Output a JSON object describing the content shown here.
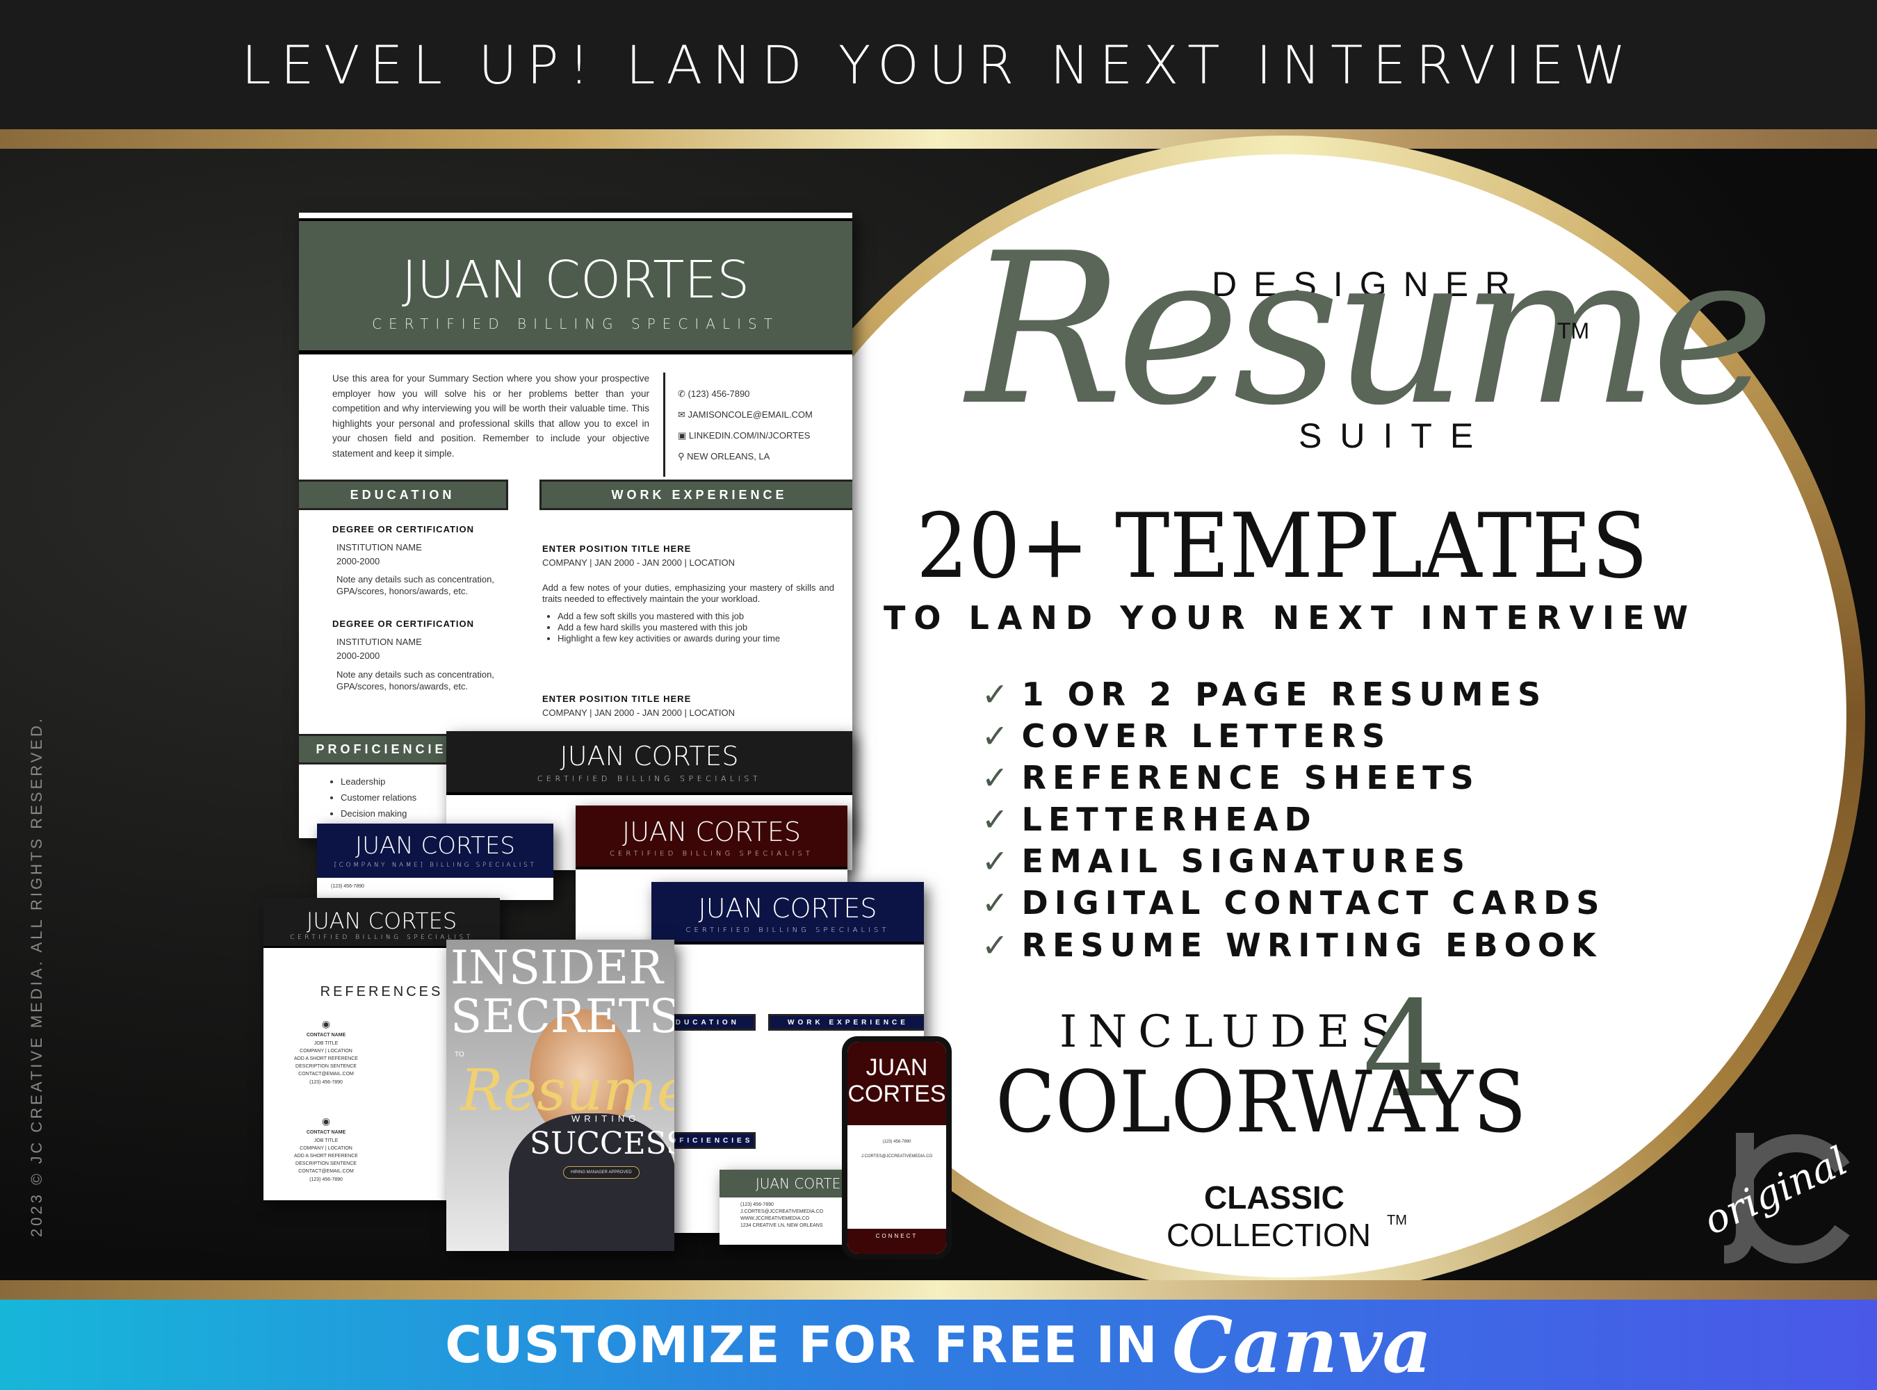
{
  "header": {
    "title": "LEVEL UP! LAND YOUR NEXT INTERVIEW"
  },
  "copyright": "2023 © JC CREATIVE MEDIA. ALL RIGHTS RESERVED.",
  "colors": {
    "green": "#4d5c4d",
    "navy": "#0c1446",
    "maroon": "#3d0606",
    "black": "#1b1b1b",
    "canva_start": "#17b6d9",
    "canva_end": "#4a58e8",
    "gold": "#c9a863"
  },
  "product": {
    "designer": "DESIGNER",
    "resume_script": "Resume",
    "tm": "TM",
    "suite": "SUITE",
    "templates": "20+ TEMPLATES",
    "tagline": "TO LAND YOUR NEXT INTERVIEW",
    "features": [
      {
        "icon": "check-icon",
        "label": "1 OR 2 PAGE RESUMES"
      },
      {
        "icon": "check-icon",
        "label": "COVER LETTERS"
      },
      {
        "icon": "check-icon",
        "label": "REFERENCE SHEETS"
      },
      {
        "icon": "check-icon",
        "label": "LETTERHEAD"
      },
      {
        "icon": "check-icon",
        "label": "EMAIL SIGNATURES"
      },
      {
        "icon": "check-icon",
        "label": "DIGITAL CONTACT CARDS"
      },
      {
        "icon": "check-icon",
        "label": "RESUME WRITING EBOOK"
      }
    ],
    "includes": "INCLUDES",
    "number": "4",
    "colorways": "COLORWAYS",
    "classic": "CLASSIC",
    "collection": "COLLECTION",
    "collection_tm": "TM",
    "logo": "JC original"
  },
  "resume": {
    "name": "JUAN CORTES",
    "title": "CERTIFIED BILLING SPECIALIST",
    "summary": "Use this area for your Summary Section where you show your prospective employer how you will solve his or her problems better than your competition and why interviewing you will be worth their valuable time. This highlights your personal and professional skills that allow you to excel in your chosen field and position. Remember to include your objective statement and keep it simple.",
    "contact": [
      {
        "icon": "phone-icon",
        "text": "(123) 456-7890"
      },
      {
        "icon": "email-icon",
        "text": "JAMISONCOLE@EMAIL.COM"
      },
      {
        "icon": "linkedin-icon",
        "text": "LINKEDIN.COM/IN/JCORTES"
      },
      {
        "icon": "location-icon",
        "text": "NEW ORLEANS, LA"
      }
    ],
    "education_heading": "EDUCATION",
    "work_heading": "WORK EXPERIENCE",
    "proficiencies_heading": "PROFICIENCIES",
    "education": [
      {
        "degree": "DEGREE OR CERTIFICATION",
        "institution": "INSTITUTION NAME",
        "years": "2000-2000",
        "note": "Note any details such as concentration, GPA/scores, honors/awards, etc."
      },
      {
        "degree": "DEGREE OR CERTIFICATION",
        "institution": "INSTITUTION NAME",
        "years": "2000-2000",
        "note": "Note any details such as concentration, GPA/scores, honors/awards, etc."
      }
    ],
    "jobs": [
      {
        "position": "ENTER POSITION TITLE HERE",
        "meta": "COMPANY  |  JAN 2000 - JAN 2000  |  LOCATION",
        "desc": "Add a few notes of your duties, emphasizing your mastery of skills and traits needed to effectively maintain the your workload.",
        "bullets": [
          "Add a few soft skills you mastered with this job",
          "Add a few hard skills you mastered with this job",
          "Highlight a few key activities or awards during your time"
        ]
      },
      {
        "position": "ENTER POSITION TITLE HERE",
        "meta": "COMPANY  |  JAN 2000 - JAN 2000  |  LOCATION"
      }
    ],
    "skills": [
      "Leadership",
      "Customer relations",
      "Decision making"
    ]
  },
  "variants": {
    "company_title": "[COMPANY NAME] BILLING SPECIALIST",
    "references_heading": "REFERENCES",
    "contact_name": "CONTACT NAME",
    "job_title": "JOB TITLE",
    "company_location": "COMPANY  |  LOCATION",
    "ref_desc": "ADD A SHORT REFERENCE DESCRIPTION SENTENCE",
    "ref_email": "CONTACT@EMAIL.COM",
    "ref_phone": "(123) 456-7890"
  },
  "ebook": {
    "line1": "INSIDER",
    "line2": "SECRETS",
    "to": "TO",
    "script": "Resume",
    "writing": "WRITING",
    "success": "SUCCESS",
    "badge": "HIRING MANAGER APPROVED"
  },
  "card": {
    "name": "JUAN CORTES",
    "lines": [
      "(123) 456-7890",
      "J.CORTES@JCCREATIVEMEDIA.CO",
      "WWW.JCCREATIVEMEDIA.CO",
      "1234 CREATIVE LN, NEW ORLEANS"
    ]
  },
  "phone": {
    "first": "JUAN",
    "last": "CORTES",
    "connect": "CONNECT"
  },
  "footer": {
    "cta": "CUSTOMIZE FOR FREE IN",
    "brand": "Canva"
  }
}
